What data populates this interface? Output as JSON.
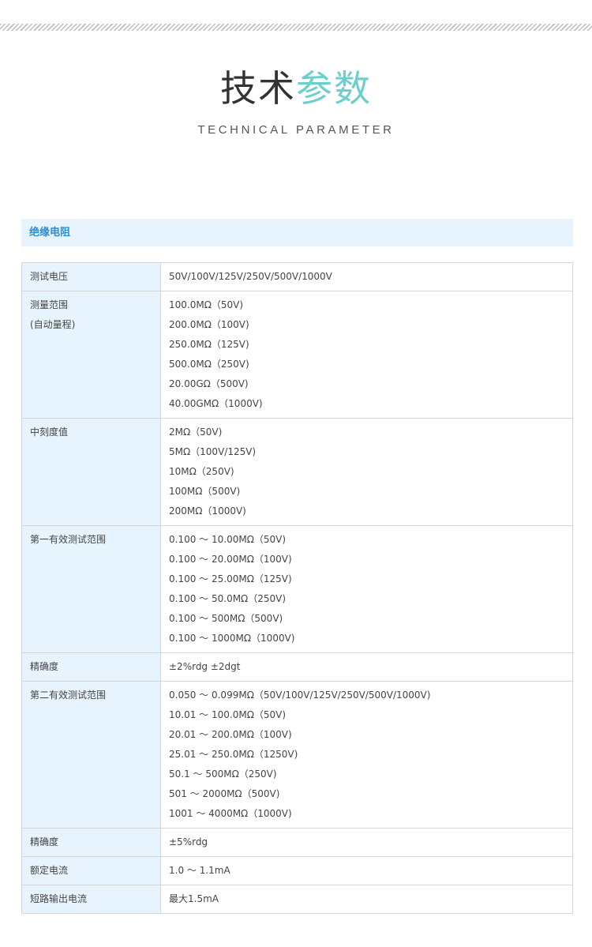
{
  "header": {
    "title_main": "技术",
    "title_accent": "参数",
    "subtitle": "TECHNICAL PARAMETER"
  },
  "colors": {
    "accent": "#6bcfcb",
    "section_bg": "#e8f4fd",
    "section_text": "#2b8ed6"
  },
  "section": {
    "title": "绝缘电阻"
  },
  "rows": [
    {
      "label": [
        "测试电压"
      ],
      "values": [
        "50V/100V/125V/250V/500V/1000V"
      ]
    },
    {
      "label": [
        "测量范围",
        "(自动量程)"
      ],
      "values": [
        "100.0MΩ（50V)",
        "200.0MΩ（100V)",
        "250.0MΩ（125V)",
        "500.0MΩ（250V)",
        "20.00GΩ（500V)",
        "40.00GMΩ（1000V)"
      ]
    },
    {
      "label": [
        "中刻度值"
      ],
      "values": [
        "2MΩ（50V)",
        "5MΩ（100V/125V)",
        "10MΩ（250V)",
        "100MΩ（500V)",
        "200MΩ（1000V)"
      ]
    },
    {
      "label": [
        "第一有效测试范围"
      ],
      "values": [
        "0.100 ～ 10.00MΩ（50V)",
        "0.100 ～ 20.00MΩ（100V)",
        "0.100 ～ 25.00MΩ（125V)",
        "0.100 ～ 50.0MΩ（250V)",
        "0.100 ～ 500MΩ（500V)",
        "0.100 ～ 1000MΩ（1000V)"
      ]
    },
    {
      "label": [
        "精确度"
      ],
      "values": [
        "±2%rdg ±2dgt"
      ]
    },
    {
      "label": [
        "第二有效测试范围"
      ],
      "values": [
        "0.050 ～ 0.099MΩ（50V/100V/125V/250V/500V/1000V)",
        "10.01 ～ 100.0MΩ（50V)",
        "20.01 ～ 200.0MΩ（100V)",
        "25.01 ～ 250.0MΩ（1250V)",
        "50.1 ～ 500MΩ（250V)",
        "501 ～ 2000MΩ（500V)",
        "1001 ～ 4000MΩ（1000V)"
      ]
    },
    {
      "label": [
        "精确度"
      ],
      "values": [
        "±5%rdg"
      ]
    },
    {
      "label": [
        "额定电流"
      ],
      "values": [
        "1.0 ～ 1.1mA"
      ]
    },
    {
      "label": [
        "短路输出电流"
      ],
      "values": [
        "最大1.5mA"
      ]
    }
  ]
}
